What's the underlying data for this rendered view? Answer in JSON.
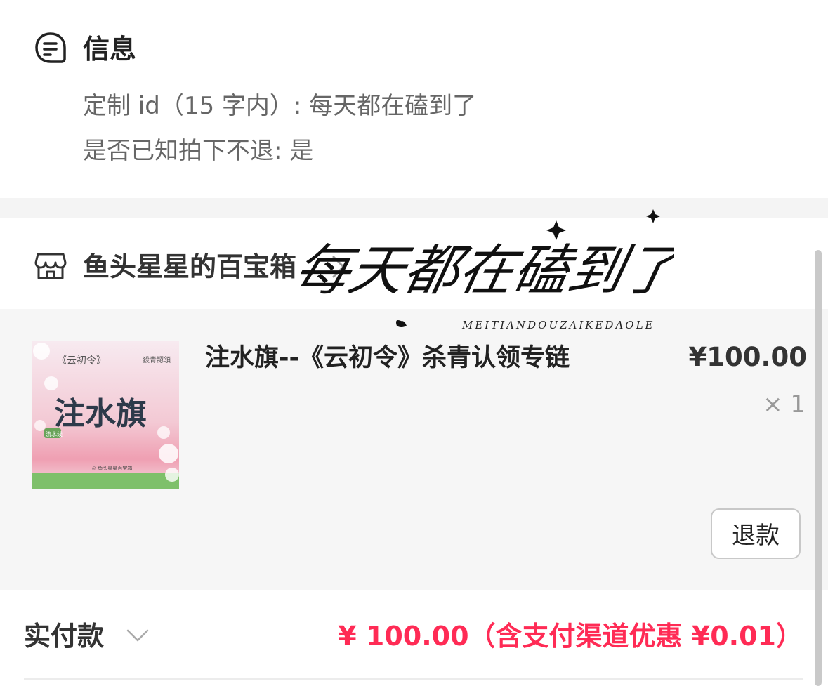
{
  "info": {
    "title": "信息",
    "icon": "message-icon",
    "line1": "定制 id（15 字内）: 每天都在磕到了",
    "line2": "是否已知拍下不退: 是"
  },
  "shop": {
    "name": "鱼头星星的百宝箱",
    "icon": "shop-icon",
    "chevron_icon": "chevron-right-icon"
  },
  "product": {
    "title": "注水旗--《云初令》杀青认领专链",
    "price": "¥100.00",
    "quantity": "× 1",
    "refund_label": "退款",
    "thumbnail": {
      "top_left": "《云初令》",
      "top_right": "殺青認領",
      "main": "注水旗",
      "tag": "流水线",
      "footer": "◎ 鱼头星星百宝箱"
    }
  },
  "payment": {
    "label": "实付款",
    "amount": "¥ 100.00（含支付渠道优惠 ¥0.01）",
    "chevron_icon": "chevron-down-icon"
  },
  "signature": {
    "text": "每天都在磕到了",
    "subtext": "MEITIANDOUZAIKEDAOLE"
  },
  "colors": {
    "accent": "#ff2b55",
    "background_gray": "#f6f6f6"
  }
}
